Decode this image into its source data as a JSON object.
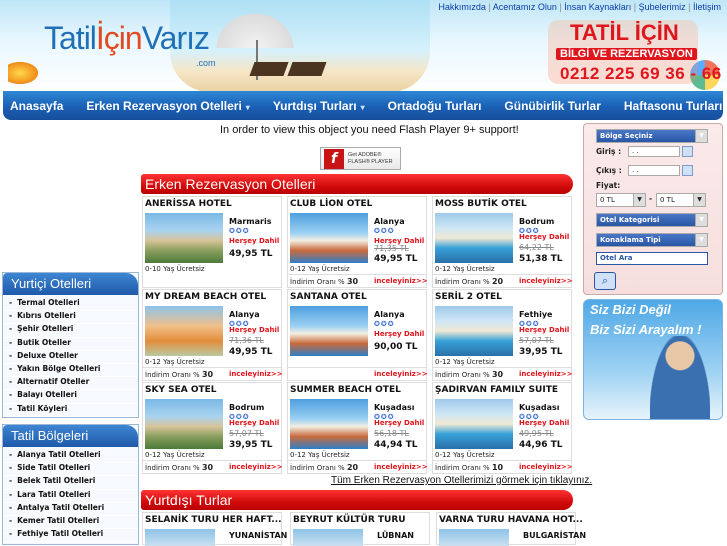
{
  "header": {
    "logo_text_1": "Tatil",
    "logo_text_2": "İçin",
    "logo_text_3": "Varız",
    "logo_com": ".com",
    "top_links": [
      "Hakkımızda",
      "Acentamız Olun",
      "İnsan Kaynakları",
      "Şubelerimiz",
      "İletişim"
    ],
    "brand_title": "TATİL İÇİN",
    "brand_subtitle": "BİLGİ VE REZERVASYON",
    "brand_phone": "0212 225 69 36 - 66"
  },
  "nav": {
    "items": [
      {
        "label": "Anasayfa",
        "dropdown": false
      },
      {
        "label": "Erken Rezervasyon Otelleri",
        "dropdown": true
      },
      {
        "label": "Yurtdışı Turları",
        "dropdown": true
      },
      {
        "label": "Ortadoğu Turları",
        "dropdown": false
      },
      {
        "label": "Günübirlik Turlar",
        "dropdown": false
      },
      {
        "label": "Haftasonu Turları",
        "dropdown": false
      }
    ]
  },
  "flash": {
    "message": "In order to view this object you need Flash Player 9+ support!",
    "button_line1": "Get ADOBE®",
    "button_line2": "FLASH® PLAYER"
  },
  "sections": {
    "early": "Erken Rezervasyon Otelleri",
    "abroad": "Yurtdışı Turlar"
  },
  "hotels": [
    {
      "name": "ANERİSSA HOTEL",
      "location": "Marmaris",
      "stars": "✪✪✪",
      "included": "Herşey Dahil",
      "old_price": "",
      "price": "49,95 TL",
      "kids": "0-10 Yaş Ücretsiz",
      "discount_label": "",
      "discount": "",
      "more": ""
    },
    {
      "name": "CLUB LİON OTEL",
      "location": "Alanya",
      "stars": "✪✪✪",
      "included": "Herşey Dahil",
      "old_price": "71,35 TL",
      "price": "49,95 TL",
      "kids": "0-12 Yaş Ücretsiz",
      "discount_label": "İndirim Oranı %",
      "discount": "30",
      "more": "inceleyiniz>>"
    },
    {
      "name": "MOSS BUTİK OTEL",
      "location": "Bodrum",
      "stars": "✪✪✪",
      "included": "Herşey Dahil",
      "old_price": "64,22 TL",
      "price": "51,38 TL",
      "kids": "0-12 Yaş Ücretsiz",
      "discount_label": "İndirim Oranı %",
      "discount": "20",
      "more": "inceleyiniz>>"
    },
    {
      "name": "MY DREAM BEACH OTEL",
      "location": "Alanya",
      "stars": "✪✪✪",
      "included": "Herşey Dahil",
      "old_price": "71,36 TL",
      "price": "49,95 TL",
      "kids": "0-12 Yaş Ücretsiz",
      "discount_label": "İndirim Oranı %",
      "discount": "30",
      "more": "inceleyiniz>>"
    },
    {
      "name": "SANTANA OTEL",
      "location": "Alanya",
      "stars": "✪✪✪",
      "included": "Herşey Dahil",
      "old_price": "",
      "price": "90,00 TL",
      "kids": "",
      "discount_label": "",
      "discount": "",
      "more": "inceleyiniz>>"
    },
    {
      "name": "SERİL 2 OTEL",
      "location": "Fethiye",
      "stars": "✪✪✪",
      "included": "Herşey Dahil",
      "old_price": "57,07 TL",
      "price": "39,95 TL",
      "kids": "0-12 Yaş Ücretsiz",
      "discount_label": "İndirim Oranı %",
      "discount": "30",
      "more": "inceleyiniz>>"
    },
    {
      "name": "SKY SEA OTEL",
      "location": "Bodrum",
      "stars": "✪✪✪",
      "included": "Herşey Dahil",
      "old_price": "57,07 TL",
      "price": "39,95 TL",
      "kids": "0-12 Yaş Ücretsiz",
      "discount_label": "İndirim Oranı %",
      "discount": "30",
      "more": "inceleyiniz>>"
    },
    {
      "name": "SUMMER BEACH OTEL",
      "location": "Kuşadası",
      "stars": "✪✪✪",
      "included": "Herşey Dahil",
      "old_price": "56,18 TL",
      "price": "44,94 TL",
      "kids": "0-12 Yaş Ücretsiz",
      "discount_label": "İndirim Oranı %",
      "discount": "20",
      "more": "inceleyiniz>>"
    },
    {
      "name": "ŞADIRVAN FAMILY SUITE",
      "location": "Kuşadası",
      "stars": "✪✪✪",
      "included": "Herşey Dahil",
      "old_price": "49,95 TL",
      "price": "44,96 TL",
      "kids": "0-12 Yaş Ücretsiz",
      "discount_label": "İndirim Oranı %",
      "discount": "10",
      "more": "inceleyiniz>>"
    }
  ],
  "all_link": "Tüm Erken Rezervasyon Otellerimizi görmek için tıklayınız.",
  "tours": [
    {
      "name": "SELANİK TURU HER HAFT...",
      "country": "YUNANİSTAN"
    },
    {
      "name": "BEYRUT KÜLTÜR TURU",
      "country": "LÜBNAN"
    },
    {
      "name": "VARNA TURU HAVANA HOT...",
      "country": "BULGARİSTAN"
    }
  ],
  "yurtici": {
    "title": "Yurtiçi Otelleri",
    "items": [
      "Termal Otelleri",
      "Kıbrıs Otelleri",
      "Şehir Otelleri",
      "Butik Oteller",
      "Deluxe Oteller",
      "Yakın Bölge Otelleri",
      "Alternatif Oteller",
      "Balayı Otelleri",
      "Tatil Köyleri"
    ]
  },
  "bolgeler": {
    "title": "Tatil Bölgeleri",
    "items": [
      "Alanya Tatil Otelleri",
      "Side Tatil Otelleri",
      "Belek Tatil Otelleri",
      "Lara Tatil Otelleri",
      "Antalya Tatil Otelleri",
      "Kemer Tatil Otelleri",
      "Fethiye Tatil Otelleri"
    ]
  },
  "search": {
    "region_select": "Bölge Seçiniz",
    "giris_label": "Giriş :",
    "giris_value": ". .",
    "cikis_label": "Çıkış :",
    "cikis_value": ". .",
    "fiyat_label": "Fiyat:",
    "min_price": "0 TL",
    "price_sep": "-",
    "max_price": "0 TL",
    "category_select": "Otel Kategorisi",
    "board_select": "Konaklama Tipi",
    "hotel_search": "Otel Ara"
  },
  "ad": {
    "line1": "Siz Bizi Değil",
    "line2": "Biz Sizi Arayalım !"
  }
}
